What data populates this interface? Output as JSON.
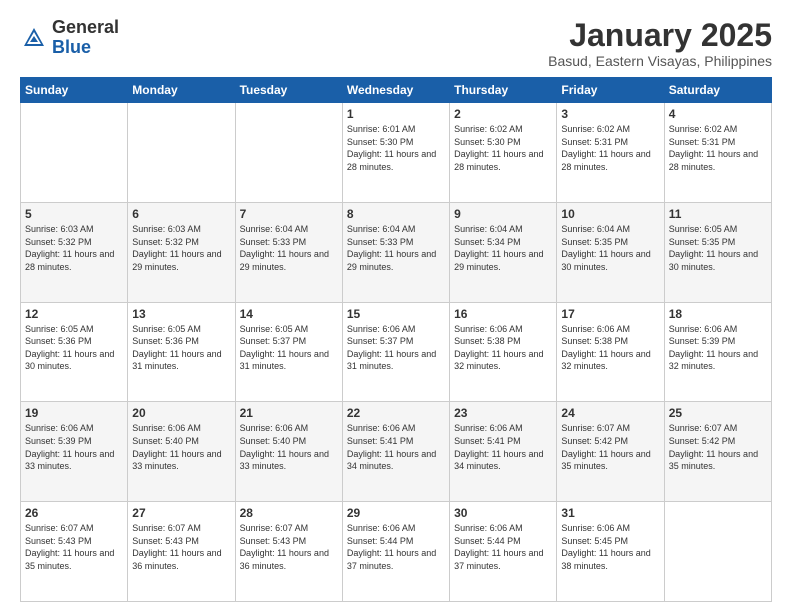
{
  "header": {
    "logo_general": "General",
    "logo_blue": "Blue",
    "month_title": "January 2025",
    "location": "Basud, Eastern Visayas, Philippines"
  },
  "days_of_week": [
    "Sunday",
    "Monday",
    "Tuesday",
    "Wednesday",
    "Thursday",
    "Friday",
    "Saturday"
  ],
  "weeks": [
    [
      {
        "day": "",
        "text": ""
      },
      {
        "day": "",
        "text": ""
      },
      {
        "day": "",
        "text": ""
      },
      {
        "day": "1",
        "text": "Sunrise: 6:01 AM\nSunset: 5:30 PM\nDaylight: 11 hours\nand 28 minutes."
      },
      {
        "day": "2",
        "text": "Sunrise: 6:02 AM\nSunset: 5:30 PM\nDaylight: 11 hours\nand 28 minutes."
      },
      {
        "day": "3",
        "text": "Sunrise: 6:02 AM\nSunset: 5:31 PM\nDaylight: 11 hours\nand 28 minutes."
      },
      {
        "day": "4",
        "text": "Sunrise: 6:02 AM\nSunset: 5:31 PM\nDaylight: 11 hours\nand 28 minutes."
      }
    ],
    [
      {
        "day": "5",
        "text": "Sunrise: 6:03 AM\nSunset: 5:32 PM\nDaylight: 11 hours\nand 28 minutes."
      },
      {
        "day": "6",
        "text": "Sunrise: 6:03 AM\nSunset: 5:32 PM\nDaylight: 11 hours\nand 29 minutes."
      },
      {
        "day": "7",
        "text": "Sunrise: 6:04 AM\nSunset: 5:33 PM\nDaylight: 11 hours\nand 29 minutes."
      },
      {
        "day": "8",
        "text": "Sunrise: 6:04 AM\nSunset: 5:33 PM\nDaylight: 11 hours\nand 29 minutes."
      },
      {
        "day": "9",
        "text": "Sunrise: 6:04 AM\nSunset: 5:34 PM\nDaylight: 11 hours\nand 29 minutes."
      },
      {
        "day": "10",
        "text": "Sunrise: 6:04 AM\nSunset: 5:35 PM\nDaylight: 11 hours\nand 30 minutes."
      },
      {
        "day": "11",
        "text": "Sunrise: 6:05 AM\nSunset: 5:35 PM\nDaylight: 11 hours\nand 30 minutes."
      }
    ],
    [
      {
        "day": "12",
        "text": "Sunrise: 6:05 AM\nSunset: 5:36 PM\nDaylight: 11 hours\nand 30 minutes."
      },
      {
        "day": "13",
        "text": "Sunrise: 6:05 AM\nSunset: 5:36 PM\nDaylight: 11 hours\nand 31 minutes."
      },
      {
        "day": "14",
        "text": "Sunrise: 6:05 AM\nSunset: 5:37 PM\nDaylight: 11 hours\nand 31 minutes."
      },
      {
        "day": "15",
        "text": "Sunrise: 6:06 AM\nSunset: 5:37 PM\nDaylight: 11 hours\nand 31 minutes."
      },
      {
        "day": "16",
        "text": "Sunrise: 6:06 AM\nSunset: 5:38 PM\nDaylight: 11 hours\nand 32 minutes."
      },
      {
        "day": "17",
        "text": "Sunrise: 6:06 AM\nSunset: 5:38 PM\nDaylight: 11 hours\nand 32 minutes."
      },
      {
        "day": "18",
        "text": "Sunrise: 6:06 AM\nSunset: 5:39 PM\nDaylight: 11 hours\nand 32 minutes."
      }
    ],
    [
      {
        "day": "19",
        "text": "Sunrise: 6:06 AM\nSunset: 5:39 PM\nDaylight: 11 hours\nand 33 minutes."
      },
      {
        "day": "20",
        "text": "Sunrise: 6:06 AM\nSunset: 5:40 PM\nDaylight: 11 hours\nand 33 minutes."
      },
      {
        "day": "21",
        "text": "Sunrise: 6:06 AM\nSunset: 5:40 PM\nDaylight: 11 hours\nand 33 minutes."
      },
      {
        "day": "22",
        "text": "Sunrise: 6:06 AM\nSunset: 5:41 PM\nDaylight: 11 hours\nand 34 minutes."
      },
      {
        "day": "23",
        "text": "Sunrise: 6:06 AM\nSunset: 5:41 PM\nDaylight: 11 hours\nand 34 minutes."
      },
      {
        "day": "24",
        "text": "Sunrise: 6:07 AM\nSunset: 5:42 PM\nDaylight: 11 hours\nand 35 minutes."
      },
      {
        "day": "25",
        "text": "Sunrise: 6:07 AM\nSunset: 5:42 PM\nDaylight: 11 hours\nand 35 minutes."
      }
    ],
    [
      {
        "day": "26",
        "text": "Sunrise: 6:07 AM\nSunset: 5:43 PM\nDaylight: 11 hours\nand 35 minutes."
      },
      {
        "day": "27",
        "text": "Sunrise: 6:07 AM\nSunset: 5:43 PM\nDaylight: 11 hours\nand 36 minutes."
      },
      {
        "day": "28",
        "text": "Sunrise: 6:07 AM\nSunset: 5:43 PM\nDaylight: 11 hours\nand 36 minutes."
      },
      {
        "day": "29",
        "text": "Sunrise: 6:06 AM\nSunset: 5:44 PM\nDaylight: 11 hours\nand 37 minutes."
      },
      {
        "day": "30",
        "text": "Sunrise: 6:06 AM\nSunset: 5:44 PM\nDaylight: 11 hours\nand 37 minutes."
      },
      {
        "day": "31",
        "text": "Sunrise: 6:06 AM\nSunset: 5:45 PM\nDaylight: 11 hours\nand 38 minutes."
      },
      {
        "day": "",
        "text": ""
      }
    ]
  ]
}
